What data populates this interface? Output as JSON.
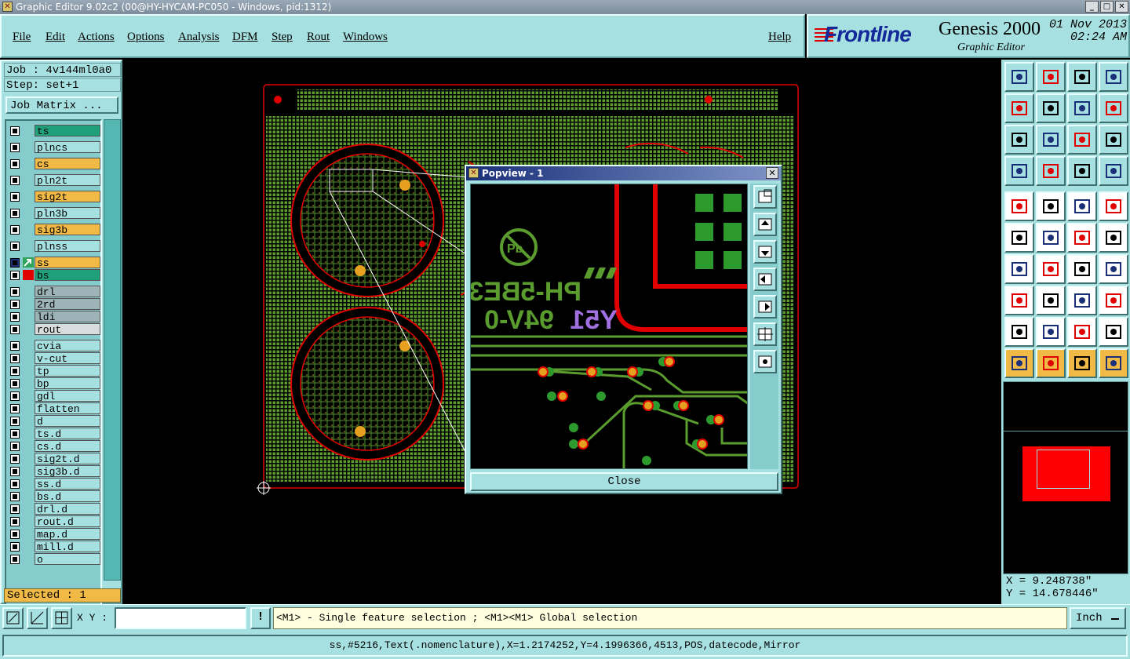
{
  "window": {
    "title": "Graphic Editor 9.02c2 (00@HY-HYCAM-PC050 - Windows, pid:1312)"
  },
  "menu": {
    "file": "File",
    "edit": "Edit",
    "actions": "Actions",
    "options": "Options",
    "analysis": "Analysis",
    "dfm": "DFM",
    "step": "Step",
    "rout": "Rout",
    "windows": "Windows",
    "help": "Help"
  },
  "brand": {
    "logo": "Frontline",
    "product": "Genesis 2000",
    "subtitle": "Graphic Editor",
    "date": "01 Nov 2013",
    "time": "02:24 AM"
  },
  "job": {
    "job_label": "Job : 4v144ml0a0",
    "step_label": "Step: set+1",
    "matrix_button": "Job Matrix ..."
  },
  "layers": [
    {
      "name": "ts",
      "color": "#20a07a"
    },
    {
      "name": "plncs",
      "color": "#a7e0e0"
    },
    {
      "name": "cs",
      "color": "#f1ba47"
    },
    {
      "name": "pln2t",
      "color": "#a7e0e0"
    },
    {
      "name": "sig2t",
      "color": "#f1ba47"
    },
    {
      "name": "pln3b",
      "color": "#a7e0e0"
    },
    {
      "name": "sig3b",
      "color": "#f1ba47"
    },
    {
      "name": "plnss",
      "color": "#a7e0e0"
    },
    {
      "name": "ss",
      "color": "#f1ba47"
    },
    {
      "name": "bs",
      "color": "#20a07a"
    },
    {
      "name": "drl",
      "color": "#9cb4b8"
    },
    {
      "name": "2rd",
      "color": "#9cb4b8"
    },
    {
      "name": "ldi",
      "color": "#9cb4b8"
    },
    {
      "name": "rout",
      "color": "#d8dcdc"
    },
    {
      "name": "cvia",
      "color": "#a7e0e0"
    },
    {
      "name": "v-cut",
      "color": "#a7e0e0"
    },
    {
      "name": "tp",
      "color": "#a7e0e0"
    },
    {
      "name": "bp",
      "color": "#a7e0e0"
    },
    {
      "name": "gdl",
      "color": "#a7e0e0"
    },
    {
      "name": "flatten",
      "color": "#a7e0e0"
    },
    {
      "name": "d",
      "color": "#a7e0e0"
    },
    {
      "name": "ts.d",
      "color": "#a7e0e0"
    },
    {
      "name": "cs.d",
      "color": "#a7e0e0"
    },
    {
      "name": "sig2t.d",
      "color": "#a7e0e0"
    },
    {
      "name": "sig3b.d",
      "color": "#a7e0e0"
    },
    {
      "name": "ss.d",
      "color": "#a7e0e0"
    },
    {
      "name": "bs.d",
      "color": "#a7e0e0"
    },
    {
      "name": "drl.d",
      "color": "#a7e0e0"
    },
    {
      "name": "rout.d",
      "color": "#a7e0e0"
    },
    {
      "name": "map.d",
      "color": "#a7e0e0"
    },
    {
      "name": "mill.d",
      "color": "#a7e0e0"
    },
    {
      "name": "o",
      "color": "#a7e0e0"
    }
  ],
  "selected": "Selected : 1",
  "popview": {
    "title": "Popview - 1",
    "close_label": "Close",
    "board_text": [
      "PH-5BE3",
      "94V-0",
      "Y51"
    ]
  },
  "coords": {
    "x": "X = 9.248738\"",
    "y": "Y = 14.678446\""
  },
  "bottom": {
    "xy_label": "X Y :",
    "xy_value": "",
    "bang": "!",
    "message": "<M1> - Single feature selection ; <M1><M1> Global selection",
    "units": "Inch"
  },
  "status": "ss,#5216,Text(.nomenclature),X=1.2174252,Y=4.1996366,4513,POS,datecode,Mirror",
  "colors": {
    "panel": "#a7e0e0",
    "accent_orange": "#f1ba47",
    "board_green": "#5b9c2e",
    "outline_red": "#e00000",
    "text_purple": "#a070e0"
  }
}
